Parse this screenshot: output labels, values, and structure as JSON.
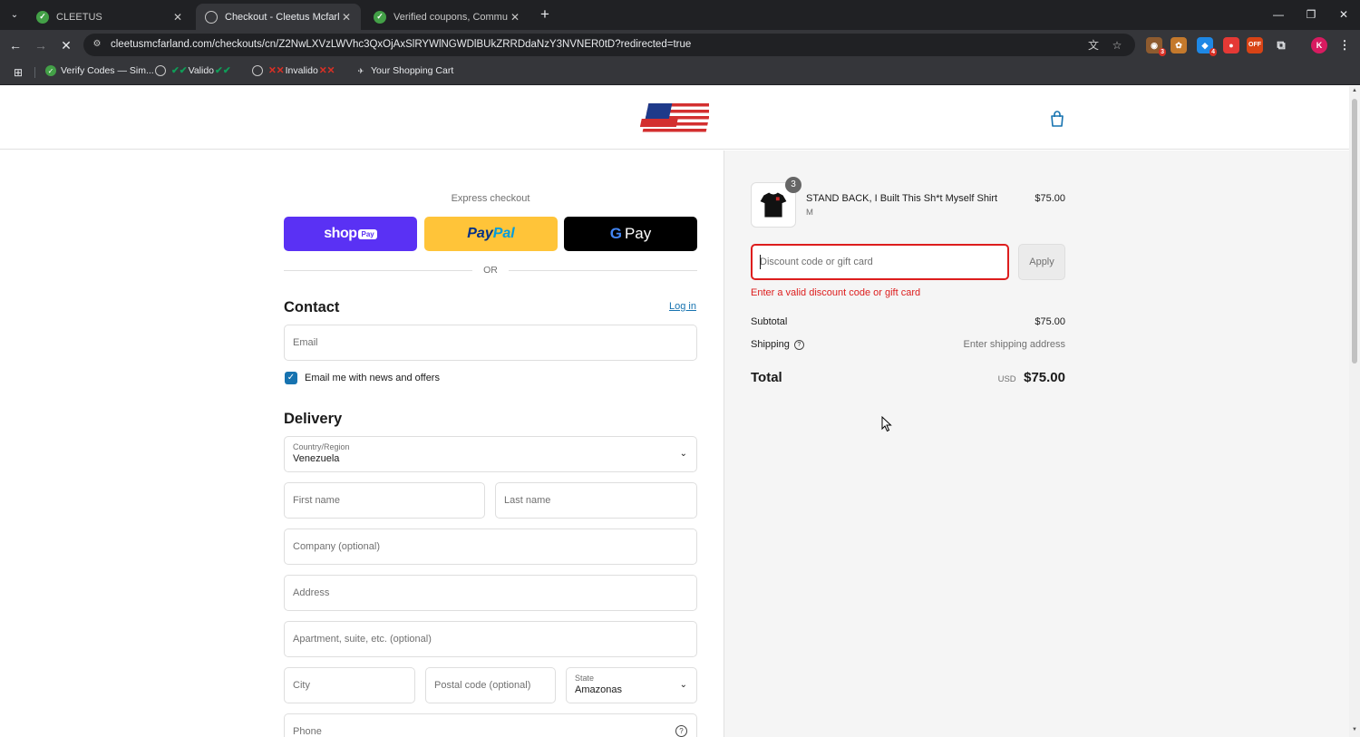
{
  "browser": {
    "tabs": [
      {
        "title": "CLEETUS",
        "active": false
      },
      {
        "title": "Checkout - Cleetus Mcfarland",
        "active": true
      },
      {
        "title": "Verified coupons, Community-p",
        "active": false
      }
    ],
    "url": "cleetusmcfarland.com/checkouts/cn/Z2NwLXVzLWVhc3QxOjAxSlRYWlNGWDlBUkZRRDdaNzY3NVNER0tD?redirected=true",
    "profile_initial": "K",
    "extension_badges": {
      "ext1": "3",
      "ext3": "4",
      "ext5": "OFF"
    },
    "bookmarks": [
      {
        "label": "Verify Codes — Sim...",
        "icon": "verify-icon"
      },
      {
        "label": "Valido",
        "icon": "globe-icon",
        "prefix": "✔✔",
        "suffix": "✔✔"
      },
      {
        "label": "Invalido",
        "icon": "globe-icon",
        "prefix": "✕✕",
        "suffix": "✕✕"
      },
      {
        "label": "Your Shopping Cart",
        "icon": "cleetus-icon"
      }
    ]
  },
  "express": {
    "title": "Express checkout",
    "shoppay_word": "shop",
    "shoppay_pill": "Pay",
    "paypal_part1": "Pay",
    "paypal_part2": "Pal",
    "gpay_letter": "G",
    "gpay_word": "Pay",
    "or": "OR"
  },
  "contact": {
    "heading": "Contact",
    "login": "Log in",
    "email_placeholder": "Email",
    "newsletter_label": "Email me with news and offers",
    "newsletter_checked": true
  },
  "delivery": {
    "heading": "Delivery",
    "country_label": "Country/Region",
    "country_value": "Venezuela",
    "first_name": "First name",
    "last_name": "Last name",
    "company": "Company (optional)",
    "address": "Address",
    "apartment": "Apartment, suite, etc. (optional)",
    "city": "City",
    "postal": "Postal code (optional)",
    "state_label": "State",
    "state_value": "Amazonas",
    "phone": "Phone"
  },
  "summary": {
    "product": {
      "name": "STAND BACK, I Built This Sh*t Myself Shirt",
      "variant": "M",
      "price": "$75.00",
      "quantity": "3"
    },
    "discount_placeholder": "Discount code or gift card",
    "apply": "Apply",
    "error": "Enter a valid discount code or gift card",
    "subtotal_label": "Subtotal",
    "subtotal_value": "$75.00",
    "shipping_label": "Shipping",
    "shipping_value": "Enter shipping address",
    "total_label": "Total",
    "currency": "USD",
    "total_value": "$75.00"
  },
  "colors": {
    "shoppay": "#5a31f4",
    "paypal": "#ffc439",
    "link": "#1773b0",
    "error": "#dd1d1d"
  }
}
